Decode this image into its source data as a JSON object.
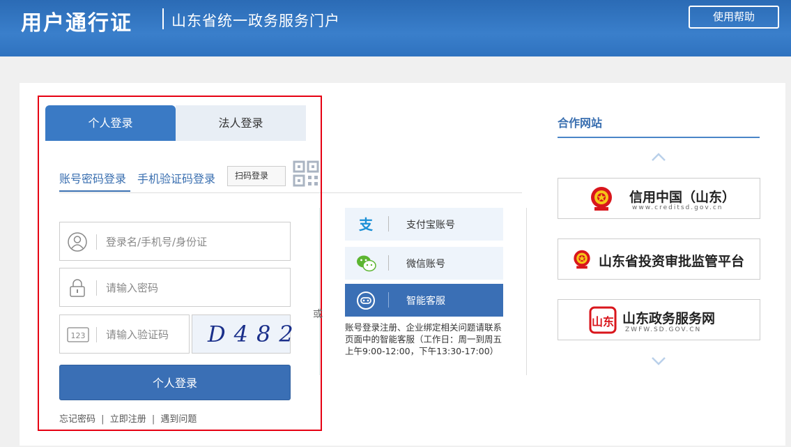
{
  "header": {
    "title": "用户通行证",
    "subtitle": "山东省统一政务服务门户",
    "help_label": "使用帮助"
  },
  "login_tabs": [
    {
      "label": "个人登录",
      "active": true
    },
    {
      "label": "法人登录",
      "active": false
    }
  ],
  "sub_tabs": {
    "account": "账号密码登录",
    "phone": "手机验证码登录",
    "scan": "扫码登录"
  },
  "form": {
    "username_placeholder": "登录名/手机号/身份证",
    "password_placeholder": "请输入密码",
    "captcha_placeholder": "请输入验证码",
    "captcha_code": "D482",
    "captcha_icon_text": "123",
    "submit_label": "个人登录"
  },
  "links": {
    "forgot": "忘记密码",
    "register": "立即注册",
    "problem": "遇到问题",
    "separator": "|"
  },
  "or_label": "或",
  "third_party": [
    {
      "label": "支付宝账号",
      "icon": "alipay-icon"
    },
    {
      "label": "微信账号",
      "icon": "wechat-icon"
    },
    {
      "label": "智能客服",
      "icon": "robot-icon"
    }
  ],
  "service_desc": "账号登录注册、企业绑定相关问题请联系页面中的智能客服（工作日：周一到周五上午9:00-12:00，下午13:30-17:00）",
  "partners": {
    "title": "合作网站",
    "items": [
      {
        "name": "信用中国（山东）",
        "sub": "www.creditsd.gov.cn"
      },
      {
        "name": "山东省投资审批监管平台",
        "sub": ""
      },
      {
        "name": "山东政务服务网",
        "sub": "ZWFW.SD.GOV.CN",
        "seal_text": "山东"
      }
    ]
  },
  "colors": {
    "header_blue": "#2f72bf",
    "tab_active": "#3a7ac5",
    "button_blue": "#3a6fb5",
    "link_blue": "#3a6fb0",
    "highlight_red": "#e60012"
  }
}
